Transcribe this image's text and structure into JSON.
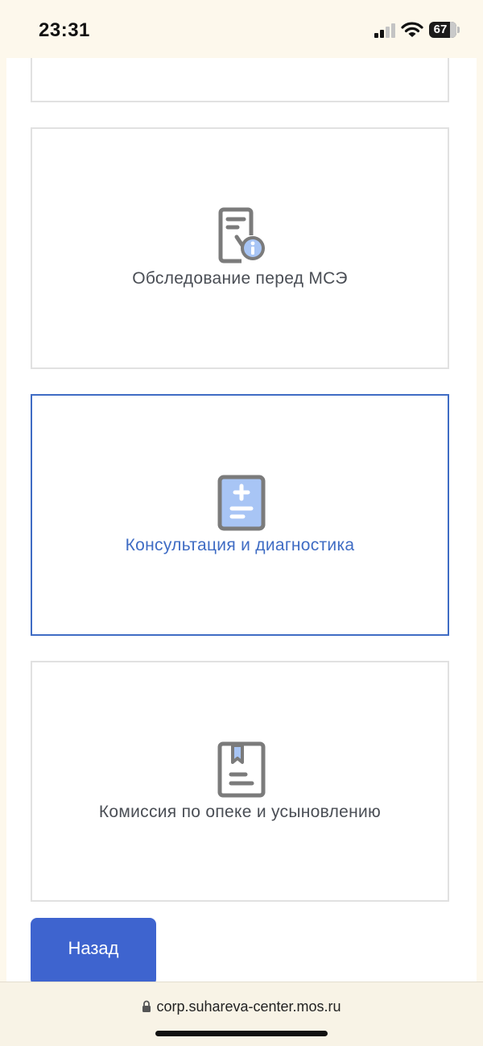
{
  "status_bar": {
    "time": "23:31",
    "battery": "67"
  },
  "cards": [
    {
      "label": "Обследование перед МСЭ",
      "icon": "document-info-icon",
      "selected": false
    },
    {
      "label": "Консультация и диагностика",
      "icon": "medical-record-icon",
      "selected": true
    },
    {
      "label": "Комиссия по опеке и усыновлению",
      "icon": "bookmark-document-icon",
      "selected": false
    }
  ],
  "back_button": {
    "label": "Назад"
  },
  "browser": {
    "url": "corp.suhareva-center.mos.ru"
  },
  "colors": {
    "accent": "#3f6cc4",
    "button": "#3e64cf",
    "icon_gray": "#7b7b7b",
    "icon_blue": "#a8c5f5"
  }
}
